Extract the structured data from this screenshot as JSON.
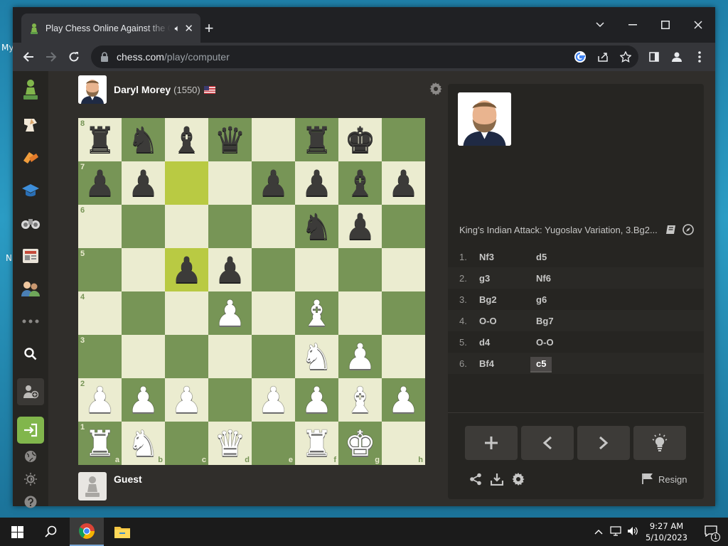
{
  "desktop": {
    "label_my": "My",
    "label_n": "N"
  },
  "browser": {
    "tab_title": "Play Chess Online Against the Computer",
    "new_tab": "+",
    "url_host": "chess.com",
    "url_path": "/play/computer"
  },
  "opponent": {
    "name": "Daryl Morey",
    "rating": "(1550)",
    "flag": "🇺🇸"
  },
  "player": {
    "name": "Guest"
  },
  "board": {
    "ranks": [
      "8",
      "7",
      "6",
      "5",
      "4",
      "3",
      "2",
      "1"
    ],
    "files": [
      "a",
      "b",
      "c",
      "d",
      "e",
      "f",
      "g",
      "h"
    ],
    "rows": [
      [
        "bR",
        "bN",
        "bB",
        "bQ",
        "",
        "bR",
        "bK",
        ""
      ],
      [
        "bP",
        "bP",
        "",
        "",
        "bP",
        "bP",
        "bB",
        "bP"
      ],
      [
        "",
        "",
        "",
        "",
        "",
        "bN",
        "bP",
        ""
      ],
      [
        "",
        "",
        "bP",
        "bP",
        "",
        "",
        "",
        ""
      ],
      [
        "",
        "",
        "",
        "wP",
        "",
        "wB",
        "",
        ""
      ],
      [
        "",
        "",
        "",
        "",
        "",
        "wN",
        "wP",
        ""
      ],
      [
        "wP",
        "wP",
        "wP",
        "",
        "wP",
        "wP",
        "wB",
        "wP"
      ],
      [
        "wR",
        "wN",
        "",
        "wQ",
        "",
        "wR",
        "wK",
        ""
      ]
    ],
    "highlights": [
      "c7",
      "c5"
    ],
    "colors": {
      "light": "#ebecd0",
      "dark": "#779556",
      "highlight": "#b9ca43"
    }
  },
  "panel": {
    "opening": "King's Indian Attack: Yugoslav Variation, 3.Bg2...",
    "moves": [
      {
        "n": "1.",
        "w": "Nf3",
        "b": "d5"
      },
      {
        "n": "2.",
        "w": "g3",
        "b": "Nf6"
      },
      {
        "n": "3.",
        "w": "Bg2",
        "b": "g6"
      },
      {
        "n": "4.",
        "w": "O-O",
        "b": "Bg7"
      },
      {
        "n": "5.",
        "w": "d4",
        "b": "O-O"
      },
      {
        "n": "6.",
        "w": "Bf4",
        "b": "c5"
      }
    ],
    "resign": "Resign"
  },
  "taskbar": {
    "time": "9:27 AM",
    "date": "5/10/2023",
    "notif_count": "1"
  },
  "icons": [
    "pawn-logo-icon",
    "puzzle-icon",
    "learn-icon",
    "binoculars-icon",
    "news-icon",
    "friends-icon",
    "more-icon",
    "search-icon",
    "add-user-icon",
    "login-icon",
    "globe-icon",
    "brightness-icon",
    "help-icon",
    "gear-icon",
    "book-icon",
    "compass-icon",
    "share-icon",
    "download-icon",
    "flag-icon",
    "lightbulb-icon"
  ]
}
